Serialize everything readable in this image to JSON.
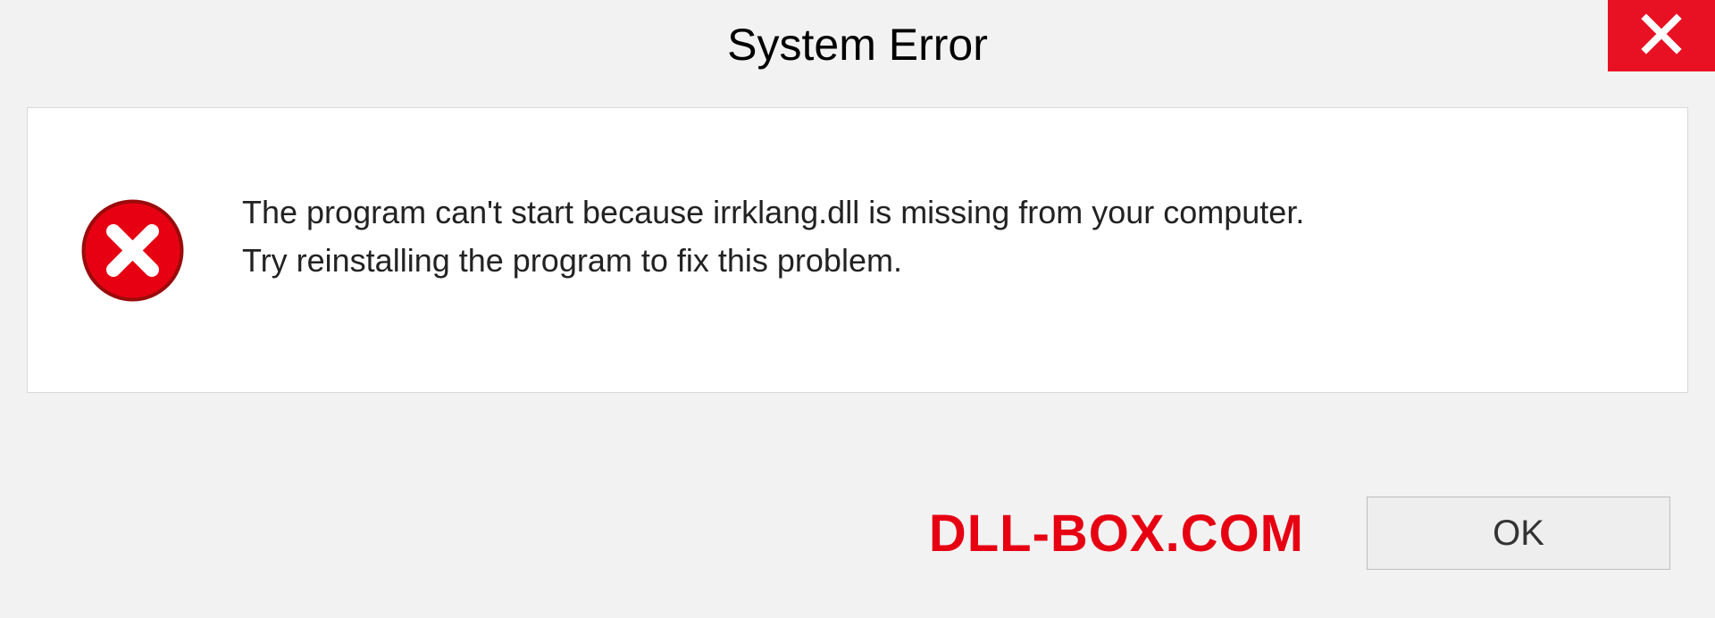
{
  "dialog": {
    "title": "System Error",
    "message_line1": "The program can't start because irrklang.dll is missing from your computer.",
    "message_line2": "Try reinstalling the program to fix this problem.",
    "ok_label": "OK"
  },
  "watermark": "DLL-BOX.COM",
  "colors": {
    "close_red": "#e81123",
    "icon_red": "#e60012",
    "watermark_red": "#e60012"
  },
  "icons": {
    "close": "close-icon",
    "error": "error-circle-x-icon"
  }
}
